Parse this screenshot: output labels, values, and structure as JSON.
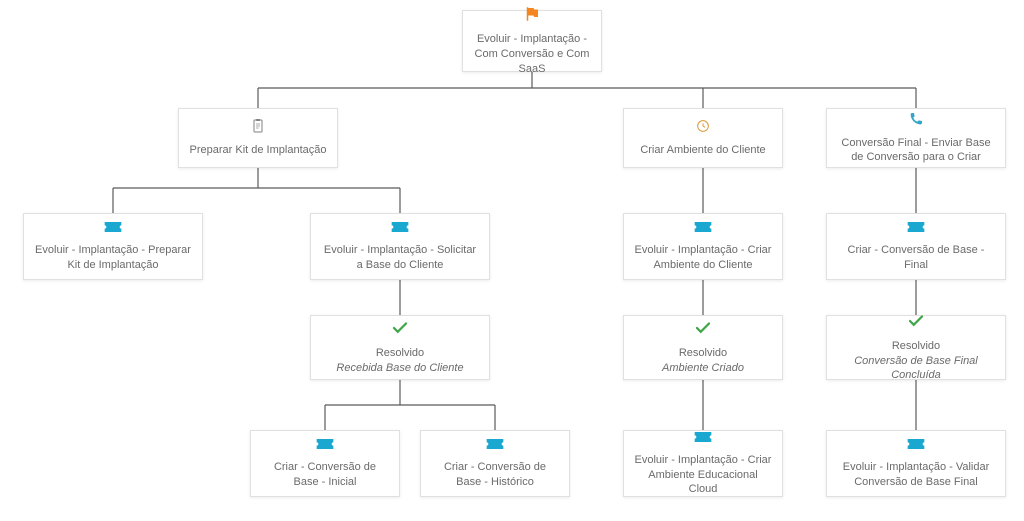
{
  "root": {
    "label": "Evoluir - Implantação - Com Conversão e Com SaaS"
  },
  "level2": {
    "n1": "Preparar Kit de Implantação",
    "n2": "Criar Ambiente do Cliente",
    "n3": "Conversão Final - Enviar Base de Conversão para o Criar"
  },
  "col1": {
    "a": "Evoluir - Implantação - Preparar Kit de Implantação",
    "b": "Evoluir - Implantação - Solicitar a Base do Cliente",
    "c_title": "Resolvido",
    "c_sub": "Recebida Base do Cliente",
    "d": "Criar - Conversão de Base - Inicial",
    "e": "Criar - Conversão de Base - Histórico"
  },
  "col2": {
    "a": "Evoluir - Implantação - Criar Ambiente do Cliente",
    "b_title": "Resolvido",
    "b_sub": "Ambiente Criado",
    "c": "Evoluir - Implantação - Criar Ambiente Educacional Cloud"
  },
  "col3": {
    "a": "Criar - Conversão de Base - Final",
    "b_title": "Resolvido",
    "b_sub": "Conversão de Base Final Concluída",
    "c": "Evoluir - Implantação - Validar Conversão de Base Final"
  },
  "icons": {
    "flag": "flag-icon",
    "clipboard": "clipboard-icon",
    "clock": "clock-icon",
    "phone": "phone-icon",
    "ticket": "ticket-icon",
    "check": "check-icon"
  }
}
